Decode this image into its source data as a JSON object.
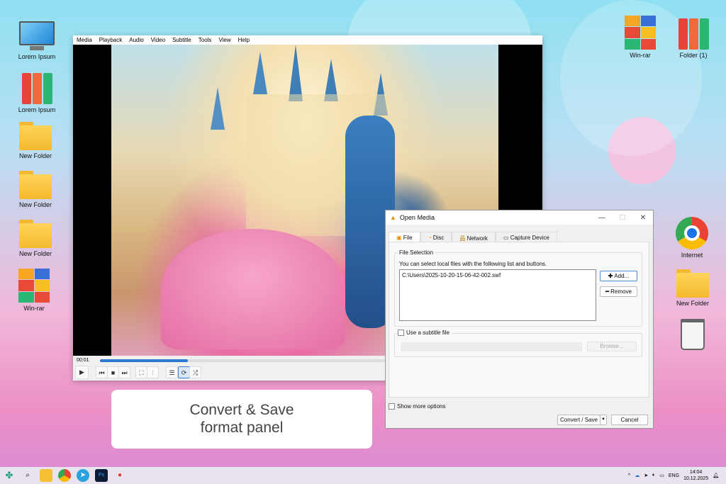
{
  "desktop_left": [
    {
      "label": "Lorem Ipsum",
      "icon": "monitor-icon"
    },
    {
      "label": "Lorem Ipsum",
      "icon": "binders-icon"
    },
    {
      "label": "New Folder",
      "icon": "folder-icon"
    },
    {
      "label": "New Folder",
      "icon": "folder-icon"
    },
    {
      "label": "New Folder",
      "icon": "folder-icon"
    },
    {
      "label": "Win-rar",
      "icon": "winrar-icon"
    }
  ],
  "desktop_right": [
    {
      "label": "Win-rar",
      "icon": "winrar-icon"
    },
    {
      "label": "Folder (1)",
      "icon": "binders-icon"
    },
    {
      "label": "Internet",
      "icon": "chrome-icon"
    },
    {
      "label": "New Folder",
      "icon": "folder-icon"
    },
    {
      "label": "",
      "icon": "recycle-bin-icon"
    }
  ],
  "vlc": {
    "menu": [
      "Media",
      "Playback",
      "Audio",
      "Video",
      "Subtitle",
      "Tools",
      "View",
      "Help"
    ],
    "time": "00:01",
    "progress_percent": 20,
    "loop_active": true
  },
  "dialog": {
    "title": "Open Media",
    "tabs": [
      "File",
      "Disc",
      "Network",
      "Capture Device"
    ],
    "file_selection_label": "File Selection",
    "instructions": "You can select local files with the following list and buttons.",
    "files": [
      "C:\\Users\\2025-10-20-15-06-42-002.swf"
    ],
    "add_label": "Add...",
    "remove_label": "Remove",
    "subtitle_label": "Use a subtitle file",
    "browse_label": "Browse...",
    "show_more_label": "Show more options",
    "convert_label": "Convert / Save",
    "cancel_label": "Cancel"
  },
  "caption": {
    "line1": "Convert & Save",
    "line2": "format panel"
  },
  "taskbar": {
    "lang": "ENG",
    "time": "14:04",
    "date": "10.12.2025"
  }
}
